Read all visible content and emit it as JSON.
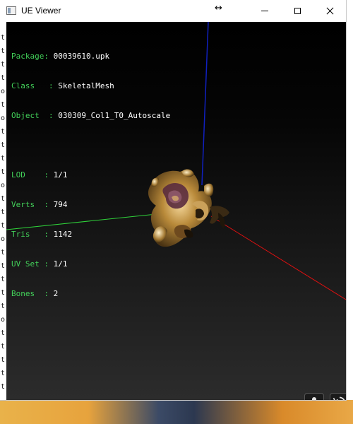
{
  "window": {
    "title": "UE Viewer",
    "icon": "app-window-icon"
  },
  "titlebar_controls": {
    "move": "resize-horizontal-icon",
    "minimize": "minimize-icon",
    "maximize": "maximize-icon",
    "close": "close-icon"
  },
  "info": {
    "package": {
      "key": "Package",
      "value": "00039610.upk"
    },
    "class": {
      "key": "Class",
      "value": "SkeletalMesh"
    },
    "object": {
      "key": "Object",
      "value": "030309_Col1_T0_Autoscale"
    },
    "lod": {
      "key": "LOD",
      "value": "1/1"
    },
    "verts": {
      "key": "Verts",
      "value": "794"
    },
    "tris": {
      "key": "Tris",
      "value": "1142"
    },
    "uvset": {
      "key": "UV Set",
      "value": "1/1"
    },
    "bones": {
      "key": "Bones",
      "value": "2"
    }
  },
  "axis_colors": {
    "x": "#e01010",
    "y": "#2fd23a",
    "z": "#1020c0"
  },
  "buttons": {
    "mic_icon": "microphone-icon",
    "rotate_icon": "rotate-icon"
  },
  "background": {
    "left_column": [
      "t",
      "t",
      "t",
      "t",
      "o",
      "t",
      "o",
      "t",
      "t",
      "t",
      "t",
      "o",
      "t",
      "t",
      "t",
      "o",
      "t",
      "t",
      "t",
      "t",
      "t",
      "o",
      "t",
      "t",
      "t",
      "t",
      "t"
    ]
  }
}
